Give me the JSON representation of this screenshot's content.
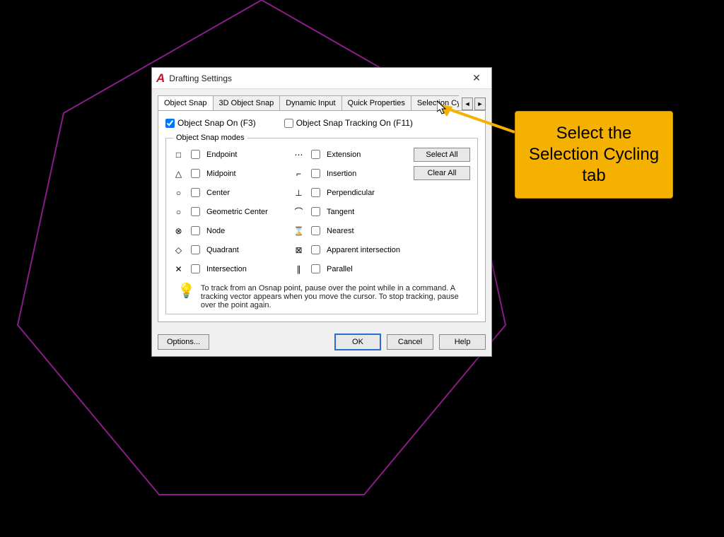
{
  "dialog": {
    "title": "Drafting Settings",
    "tabs": {
      "t0": "Object Snap",
      "t1": "3D Object Snap",
      "t2": "Dynamic Input",
      "t3": "Quick Properties",
      "t4": "Selection Cycling"
    },
    "osnap_on": "Object Snap On (F3)",
    "osnap_track": "Object Snap Tracking On (F11)",
    "modes_legend": "Object Snap modes",
    "modes": {
      "endpoint": "Endpoint",
      "midpoint": "Midpoint",
      "center": "Center",
      "geocenter": "Geometric Center",
      "node": "Node",
      "quadrant": "Quadrant",
      "intersection": "Intersection",
      "extension": "Extension",
      "insertion": "Insertion",
      "perpendicular": "Perpendicular",
      "tangent": "Tangent",
      "nearest": "Nearest",
      "appint": "Apparent intersection",
      "parallel": "Parallel"
    },
    "buttons": {
      "select_all": "Select All",
      "clear_all": "Clear All",
      "options": "Options...",
      "ok": "OK",
      "cancel": "Cancel",
      "help": "Help"
    },
    "tip": "To track from an Osnap point, pause over the point while in a command.  A tracking vector appears when you move the cursor.  To stop tracking, pause over the point again."
  },
  "callout": {
    "text": "Select the Selection Cycling tab"
  }
}
